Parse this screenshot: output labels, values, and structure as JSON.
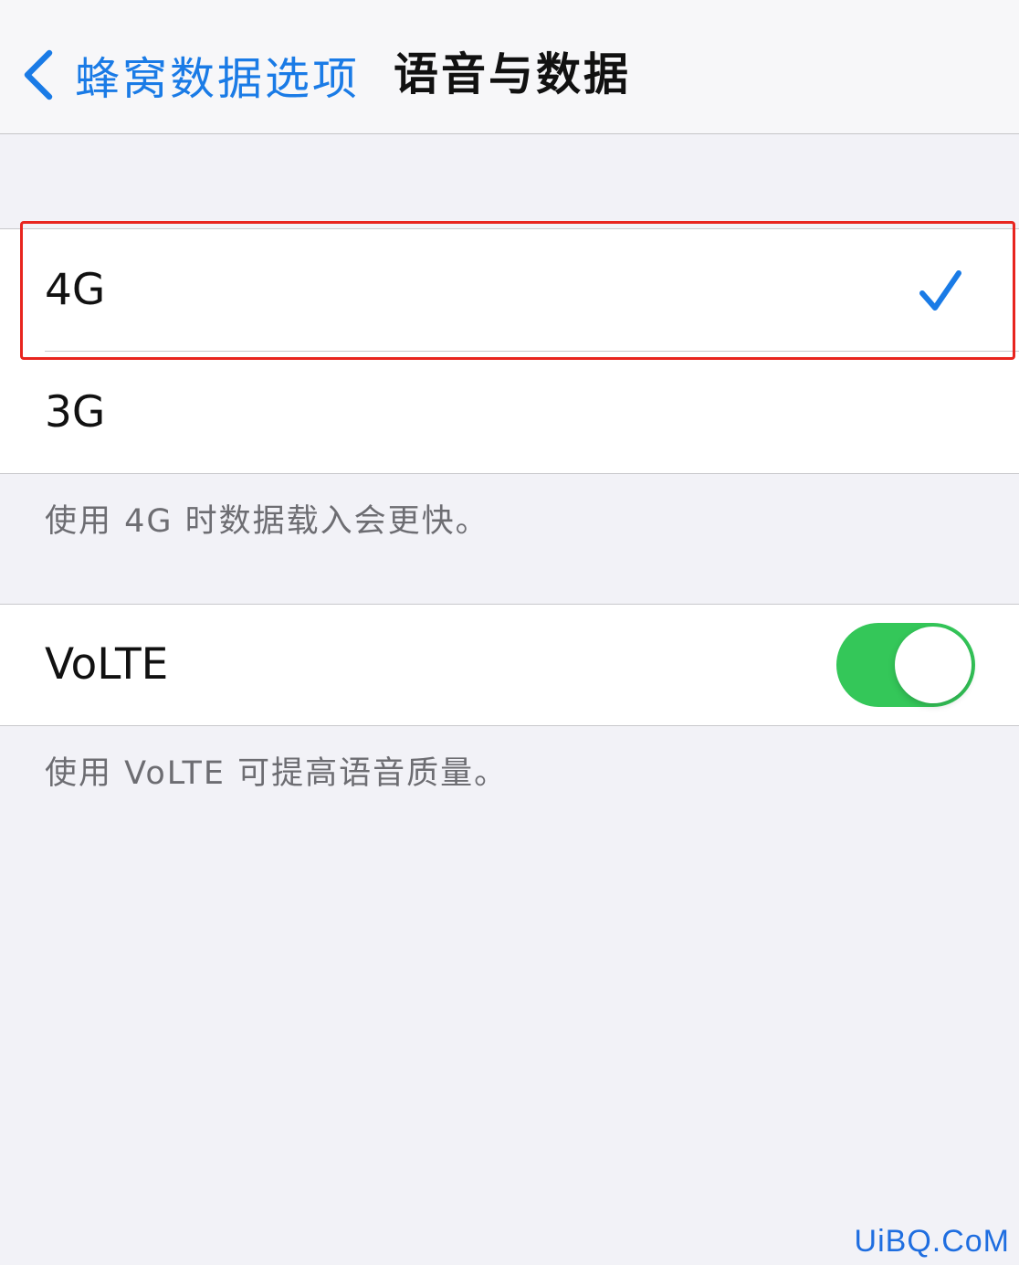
{
  "navbar": {
    "back_label": "蜂窝数据选项",
    "title": "语音与数据"
  },
  "network_options": {
    "items": [
      {
        "label": "4G",
        "selected": true
      },
      {
        "label": "3G",
        "selected": false
      }
    ],
    "footnote": "使用 4G 时数据载入会更快。"
  },
  "volte": {
    "label": "VoLTE",
    "enabled": true,
    "footnote": "使用 VoLTE 可提高语音质量。"
  },
  "watermark": "UiBQ.CoM",
  "colors": {
    "accent": "#1a7be6",
    "toggle_on": "#34c759",
    "highlight": "#e8251f"
  }
}
